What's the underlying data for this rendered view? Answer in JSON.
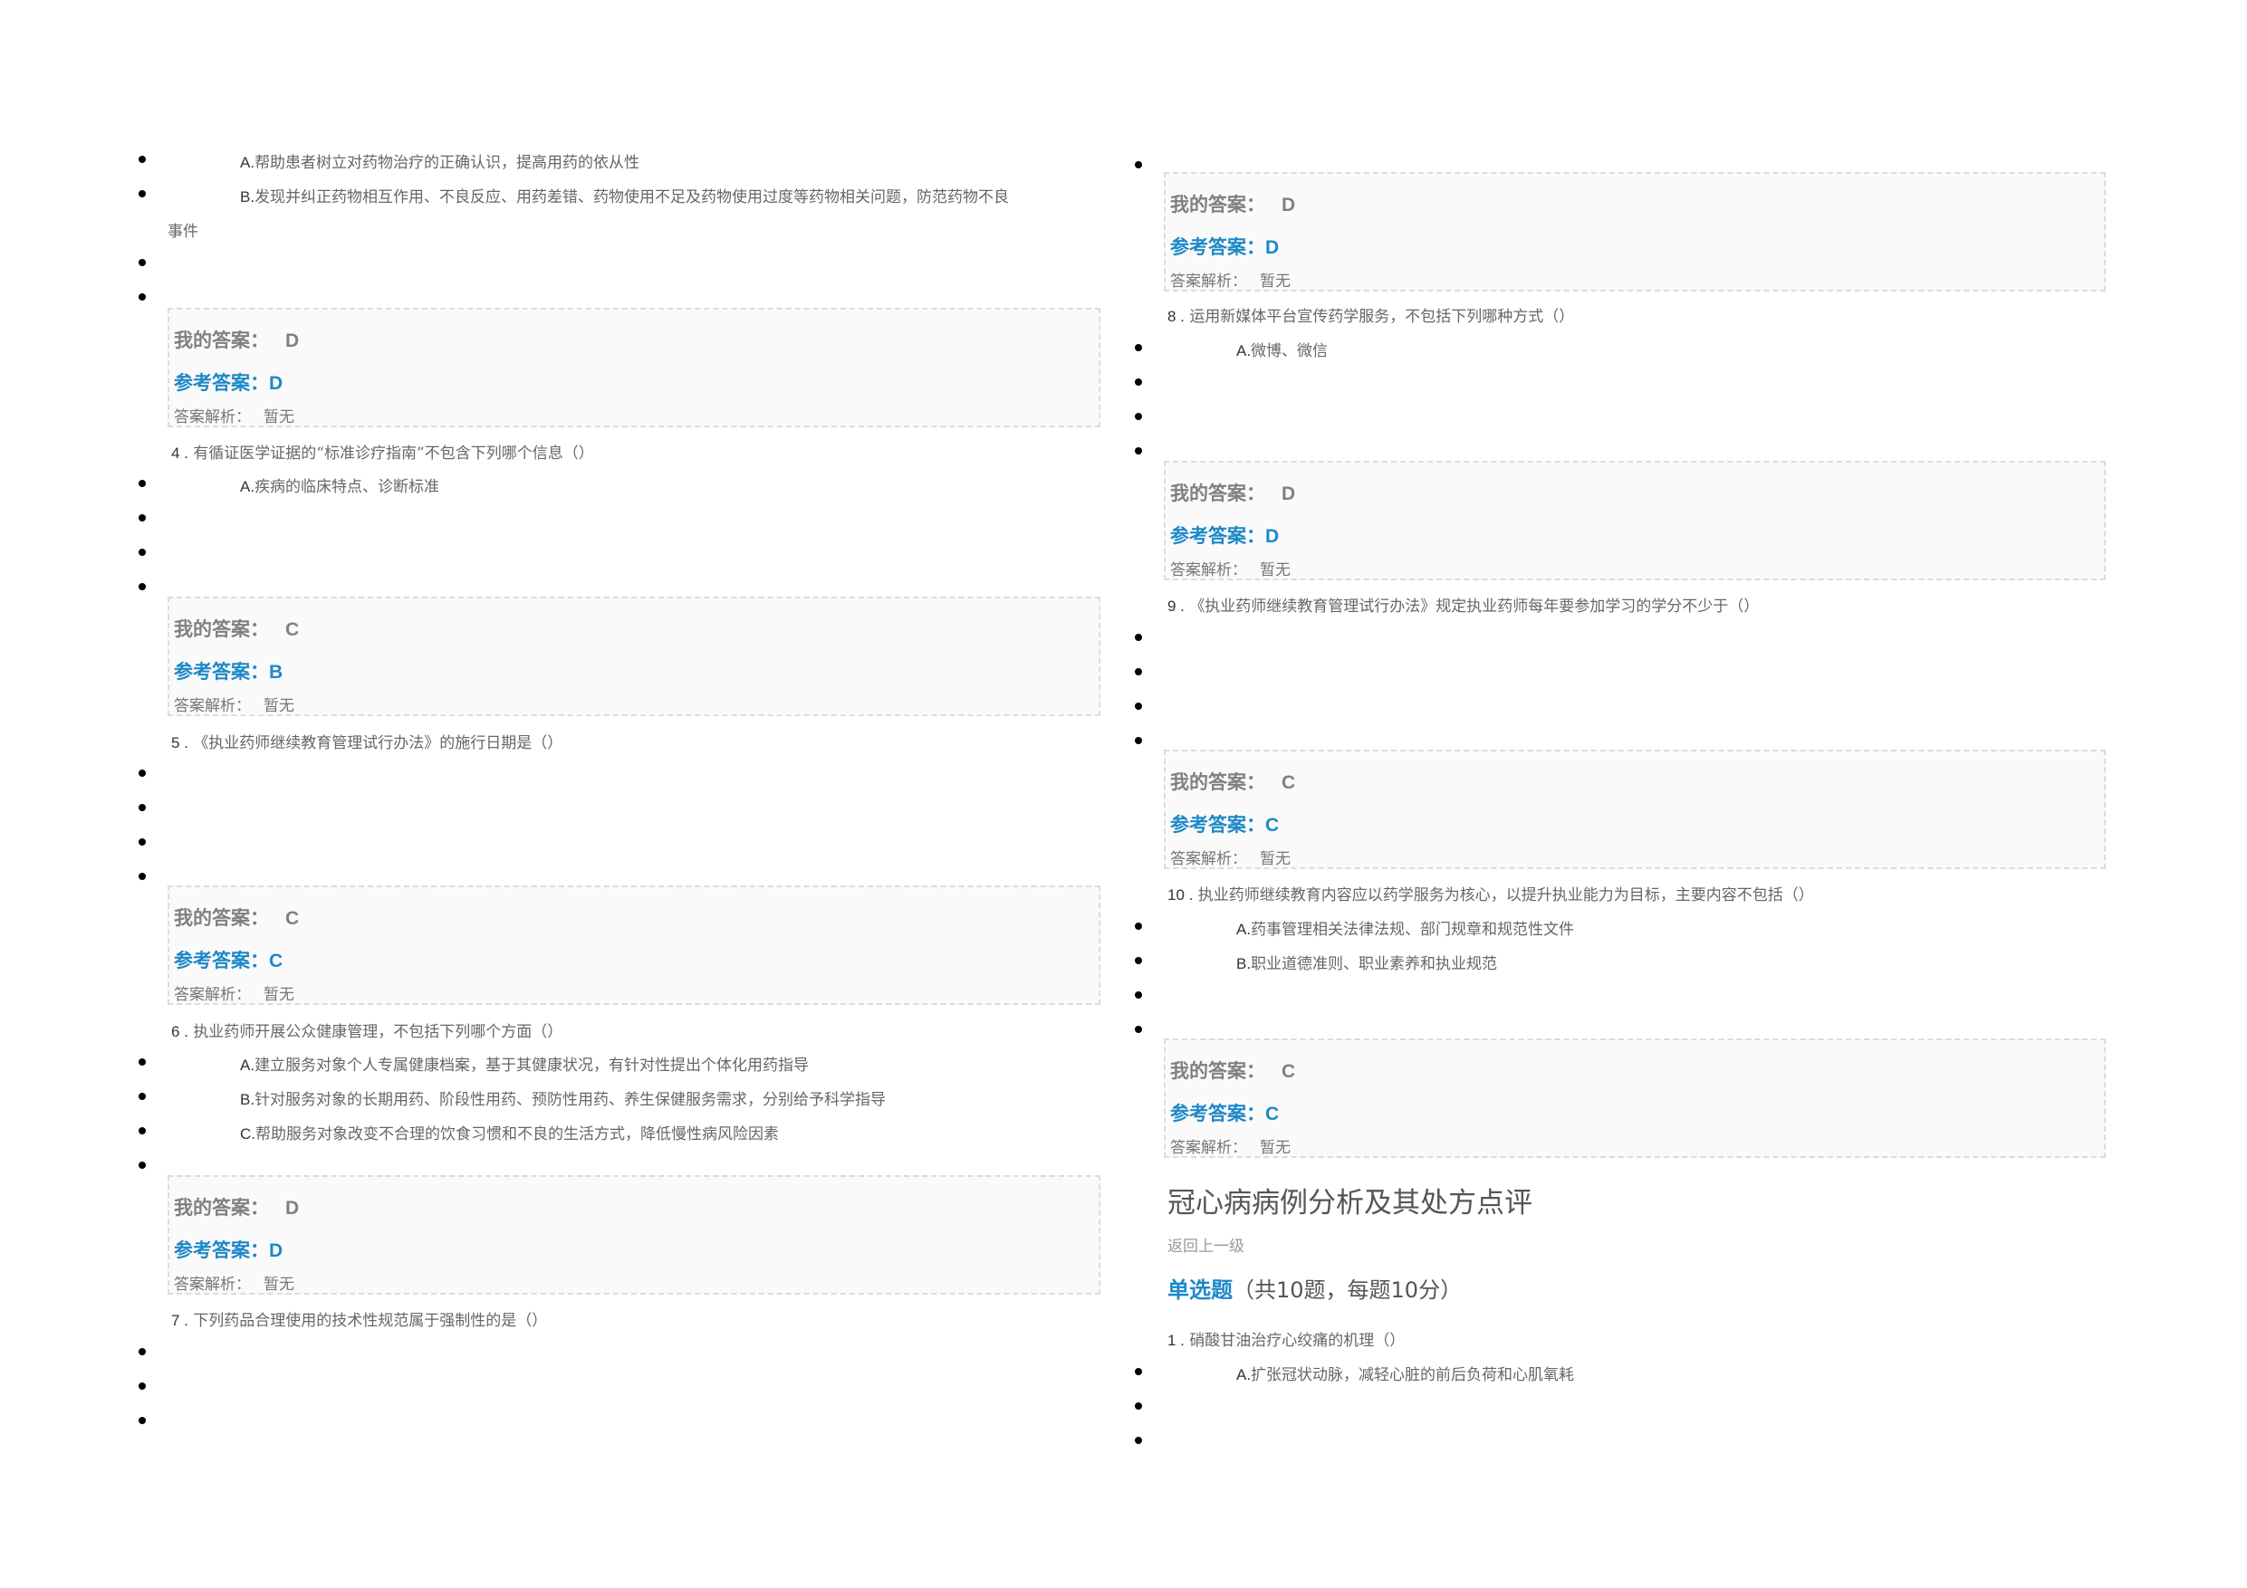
{
  "labels": {
    "my_answer": "我的答案：",
    "ref_answer": "参考答案：",
    "analysis": "答案解析："
  },
  "left": {
    "q3": {
      "optA": {
        "letter": "A.",
        "text": "帮助患者树立对药物治疗的正确认识，提高用药的依从性"
      },
      "optB": {
        "letter": "B.",
        "text": "发现并纠正药物相互作用、不良反应、用药差错、药物使用不足及药物使用过度等药物相关问题，防范药物不良",
        "cont": "事件"
      },
      "my": "D",
      "ref": "D",
      "analysis": "暂无"
    },
    "q4": {
      "num": "4 .",
      "text": "有循证医学证据的“标准诊疗指南”不包含下列哪个信息（）",
      "optA": {
        "letter": "A.",
        "text": "疾病的临床特点、诊断标准"
      },
      "my": "C",
      "ref": "B",
      "analysis": "暂无"
    },
    "q5": {
      "num": "5 .",
      "text": "《执业药师继续教育管理试行办法》的施行日期是（）",
      "my": "C",
      "ref": "C",
      "analysis": "暂无"
    },
    "q6": {
      "num": "6 .",
      "text": "执业药师开展公众健康管理，不包括下列哪个方面（）",
      "optA": {
        "letter": "A.",
        "text": "建立服务对象个人专属健康档案，基于其健康状况，有针对性提出个体化用药指导"
      },
      "optB": {
        "letter": "B.",
        "text": "针对服务对象的长期用药、阶段性用药、预防性用药、养生保健服务需求，分别给予科学指导"
      },
      "optC": {
        "letter": "C.",
        "text": "帮助服务对象改变不合理的饮食习惯和不良的生活方式，降低慢性病风险因素"
      },
      "my": "D",
      "ref": "D",
      "analysis": "暂无"
    },
    "q7": {
      "num": "7 .",
      "text": "下列药品合理使用的技术性规范属于强制性的是（）"
    }
  },
  "right": {
    "q7": {
      "my": "D",
      "ref": "D",
      "analysis": "暂无"
    },
    "q8": {
      "num": "8 .",
      "text": "运用新媒体平台宣传药学服务，不包括下列哪种方式（）",
      "optA": {
        "letter": "A.",
        "text": "微博、微信"
      },
      "my": "D",
      "ref": "D",
      "analysis": "暂无"
    },
    "q9": {
      "num": "9 .",
      "text": "《执业药师继续教育管理试行办法》规定执业药师每年要参加学习的学分不少于（）",
      "my": "C",
      "ref": "C",
      "analysis": "暂无"
    },
    "q10": {
      "num": "10 .",
      "text": "执业药师继续教育内容应以药学服务为核心，以提升执业能力为目标，主要内容不包括（）",
      "optA": {
        "letter": "A.",
        "text": "药事管理相关法律法规、部门规章和规范性文件"
      },
      "optB": {
        "letter": "B.",
        "text": "职业道德准则、职业素养和执业规范"
      },
      "my": "C",
      "ref": "C",
      "analysis": "暂无"
    },
    "section": {
      "title": "冠心病病例分析及其处方点评",
      "back": "返回上一级",
      "type_key": "单选题",
      "type_rest": "（共10题，每题10分）"
    },
    "s2q1": {
      "num": "1 .",
      "text": "硝酸甘油治疗心绞痛的机理（）",
      "optA": {
        "letter": "A.",
        "text": "扩张冠状动脉，减轻心脏的前后负荷和心肌氧耗"
      }
    }
  }
}
